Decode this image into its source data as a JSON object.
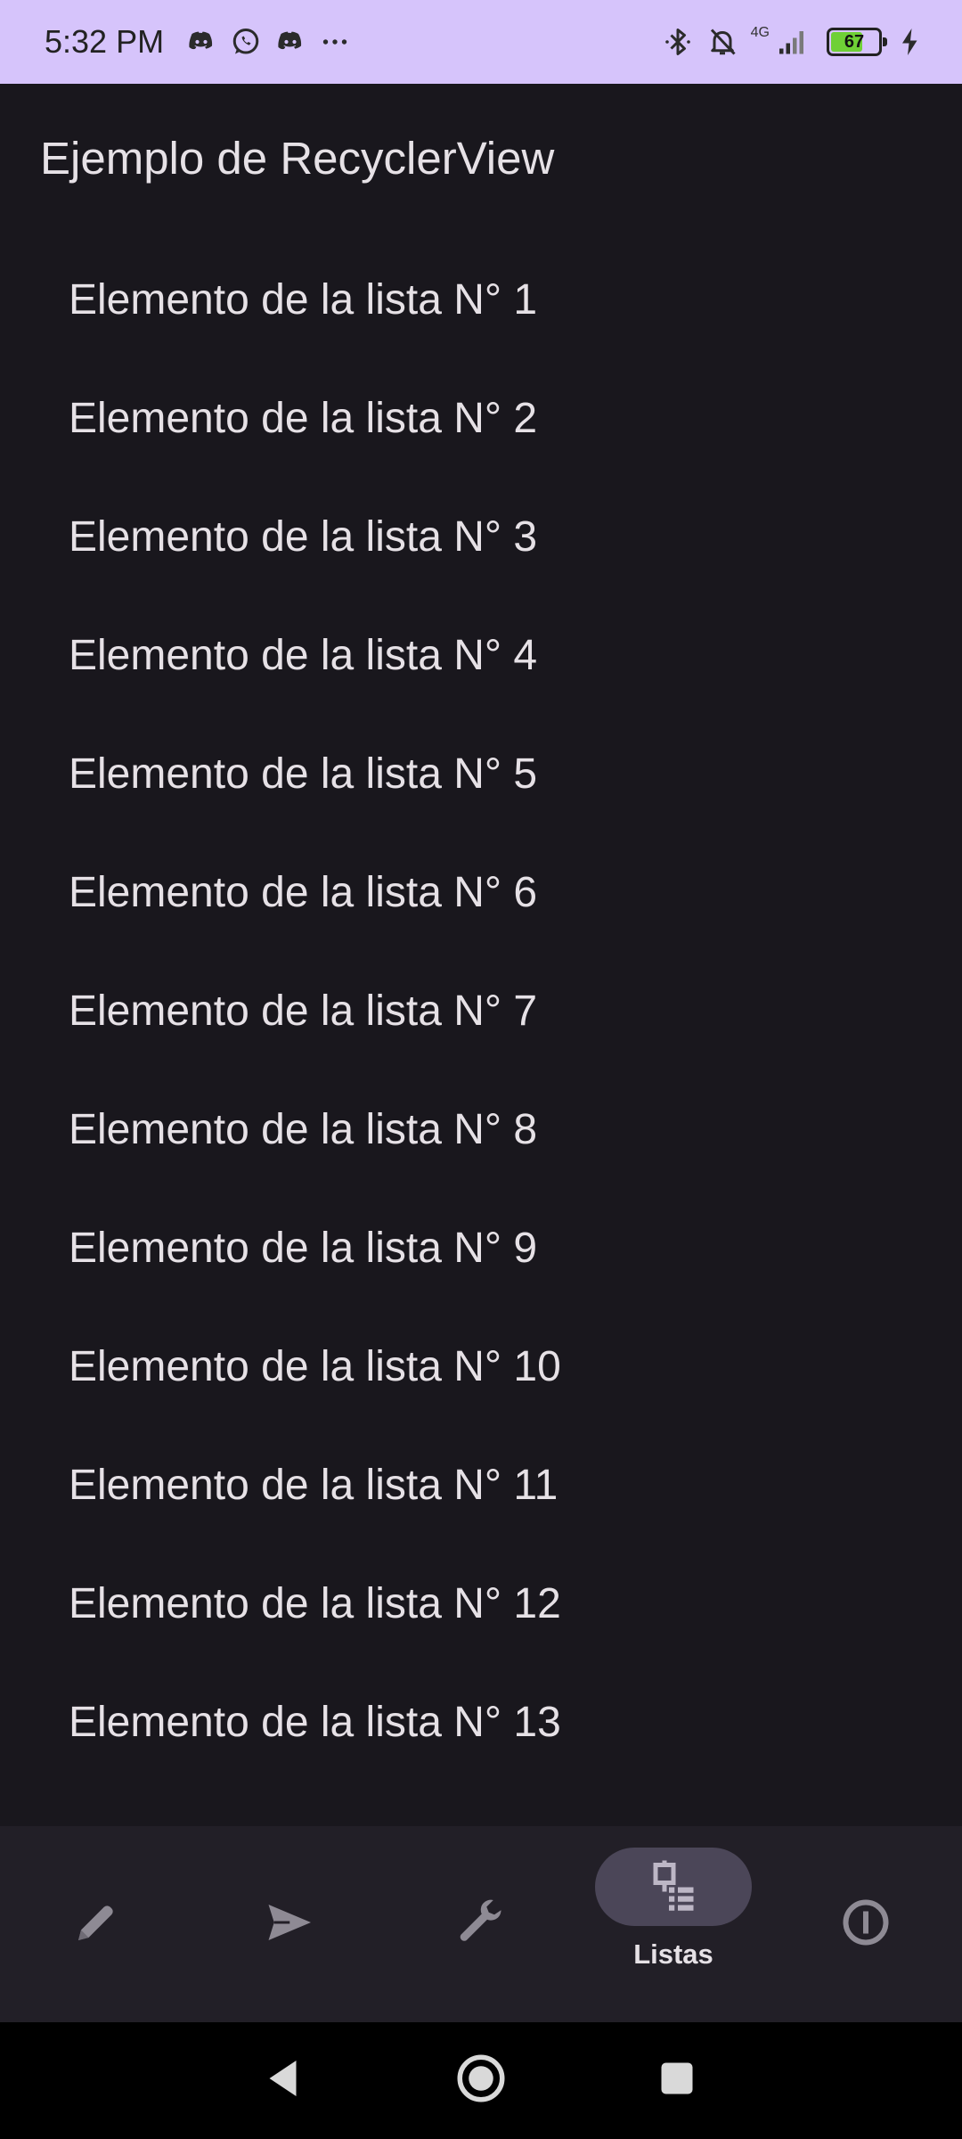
{
  "status_bar": {
    "time": "5:32 PM",
    "network_label": "4G",
    "battery_level": "67",
    "battery_fraction": 0.67,
    "icons": [
      "discord-icon",
      "whatsapp-icon",
      "discord-icon",
      "more-dots-icon",
      "bluetooth-icon",
      "bell-muted-icon",
      "signal-icon",
      "battery-icon",
      "charging-icon"
    ]
  },
  "app": {
    "title": "Ejemplo de RecyclerView"
  },
  "list": {
    "items": [
      "Elemento de la lista N° 1",
      "Elemento de la lista N° 2",
      "Elemento de la lista N° 3",
      "Elemento de la lista N° 4",
      "Elemento de la lista N° 5",
      "Elemento de la lista N° 6",
      "Elemento de la lista N° 7",
      "Elemento de la lista N° 8",
      "Elemento de la lista N° 9",
      "Elemento de la lista N° 10",
      "Elemento de la lista N° 11",
      "Elemento de la lista N° 12",
      "Elemento de la lista N° 13"
    ]
  },
  "bottom_nav": {
    "items": [
      {
        "icon": "pencil-icon",
        "label": ""
      },
      {
        "icon": "send-icon",
        "label": ""
      },
      {
        "icon": "wrench-icon",
        "label": ""
      },
      {
        "icon": "list-icon",
        "label": "Listas",
        "selected": true
      },
      {
        "icon": "info-icon",
        "label": ""
      }
    ]
  },
  "system_nav": {
    "buttons": [
      "back-icon",
      "home-icon",
      "recents-icon"
    ]
  },
  "colors": {
    "background": "#19171d",
    "status_bar": "#d6c4fb",
    "nav_background": "#221f27",
    "nav_pill": "#4b4658",
    "text": "#e6e1e6",
    "icon_inactive": "#8e8a94"
  }
}
